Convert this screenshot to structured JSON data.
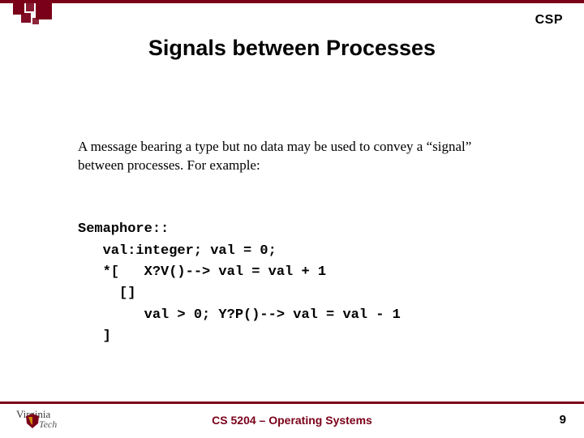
{
  "header": {
    "topic": "CSP",
    "title": "Signals between Processes"
  },
  "content": {
    "lead": "A message bearing a type but no data may be used to convey a “signal” between processes. For example:",
    "code_lines": [
      "Semaphore::",
      "   val:integer; val = 0;",
      "   *[   X?V()--> val = val + 1",
      "     []",
      "        val > 0; Y?P()--> val = val - 1",
      "   ]"
    ]
  },
  "footer": {
    "course": "CS 5204 – Operating Systems",
    "page": "9",
    "logo_top": "Virginia",
    "logo_bottom": "Tech"
  },
  "colors": {
    "accent": "#7a0019"
  }
}
